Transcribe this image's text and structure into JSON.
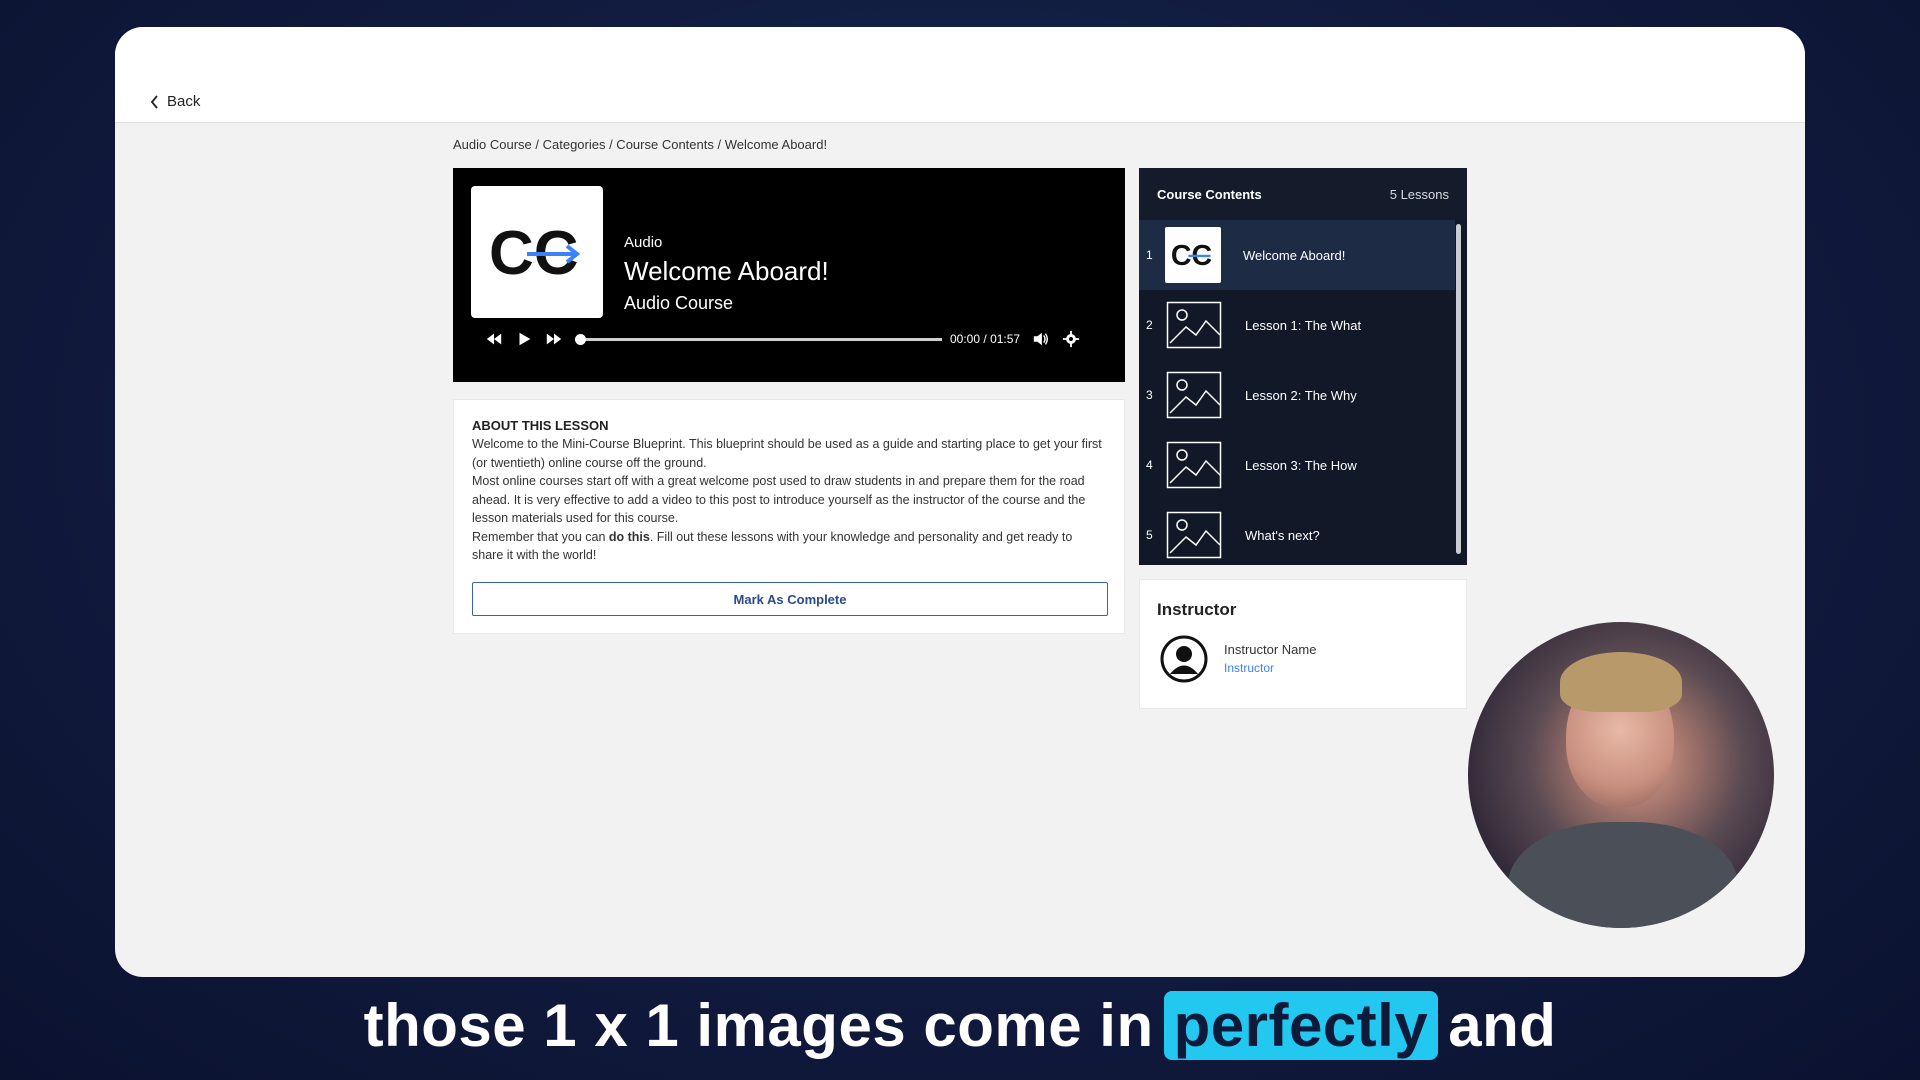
{
  "nav": {
    "back_label": "Back"
  },
  "breadcrumb": "Audio Course / Categories / Course Contents / Welcome Aboard!",
  "player": {
    "type_label": "Audio",
    "title": "Welcome Aboard!",
    "course": "Audio Course",
    "current_time": "00:00",
    "time_separator": "/",
    "duration": "01:57",
    "progress_fraction": 0
  },
  "about": {
    "heading": "ABOUT THIS LESSON",
    "para1": "Welcome to the Mini-Course Blueprint. This blueprint should be used as a guide and starting place to get your first (or twentieth) online course off the ground.",
    "para2": "Most online courses start off with a great welcome post used to draw students in and prepare them for the road ahead. It is very effective to add a video to this post to introduce yourself as the instructor of the course and the lesson materials used for this course.",
    "para3_start": "Remember that you can ",
    "para3_bold": "do this",
    "para3_end": ". Fill out these lessons with your knowledge and personality and get ready to share it with the world!",
    "complete_button": "Mark As Complete"
  },
  "contents": {
    "title": "Course Contents",
    "count": "5 Lessons",
    "lessons": [
      {
        "num": "1",
        "label": "Welcome Aboard!"
      },
      {
        "num": "2",
        "label": "Lesson 1: The What"
      },
      {
        "num": "3",
        "label": "Lesson 2: The Why"
      },
      {
        "num": "4",
        "label": "Lesson 3: The How"
      },
      {
        "num": "5",
        "label": "What's next?"
      }
    ]
  },
  "instructor": {
    "heading": "Instructor",
    "name": "Instructor Name",
    "role": "Instructor"
  },
  "caption": {
    "before": "those 1 x 1 images come in",
    "highlight": "perfectly",
    "after": "and"
  },
  "colors": {
    "accent": "#3b82f6",
    "caption_highlight": "#22c8f0",
    "contents_bg": "#111827"
  }
}
